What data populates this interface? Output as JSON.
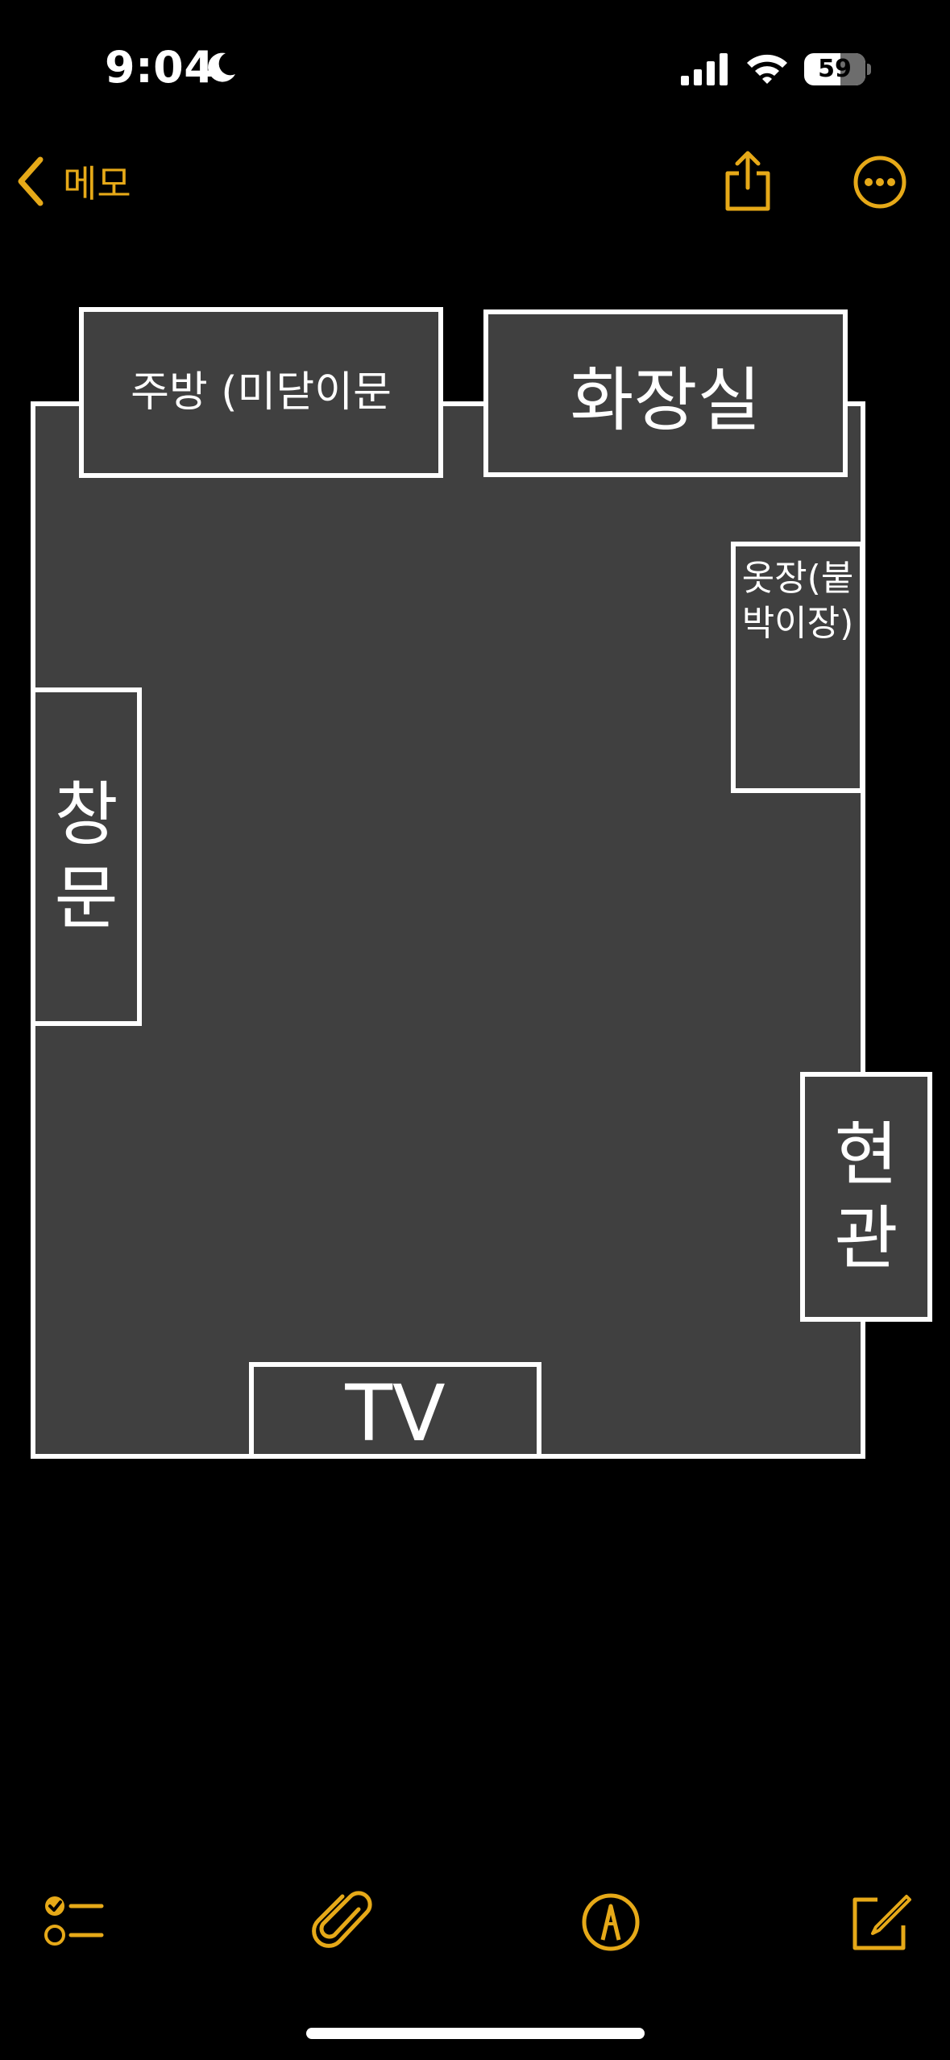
{
  "status_bar": {
    "time": "9:04",
    "battery": "59",
    "battery_level": 0.59
  },
  "nav": {
    "back_label": "메모"
  },
  "floor_plan": {
    "kitchen": "주방 (미닫이문",
    "bathroom": "화장실",
    "closet": "옷장(붙박이장)",
    "window": "창문",
    "entrance": "현관",
    "tv": "TV"
  },
  "toolbar": {
    "checklist_icon": "checklist-icon",
    "attachment_icon": "paperclip-icon",
    "markup_icon": "markup-pen-icon",
    "compose_icon": "compose-icon"
  },
  "colors": {
    "accent": "#e6a918",
    "background": "#000000",
    "room_fill": "#404040",
    "wall": "#ffffff"
  }
}
